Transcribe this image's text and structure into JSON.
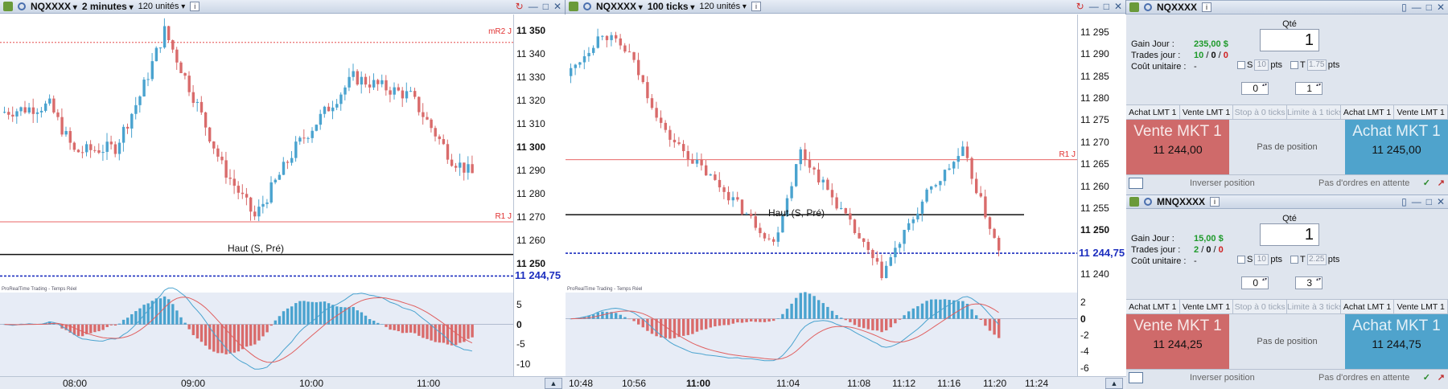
{
  "left_chart": {
    "ticker": "NQXXXX",
    "period": "2 minutes",
    "units": "120 unités",
    "price_ticks": [
      {
        "label": "11 350",
        "bold": true,
        "y": 11350
      },
      {
        "label": "11 340",
        "bold": false,
        "y": 11340
      },
      {
        "label": "11 330",
        "bold": false,
        "y": 11330
      },
      {
        "label": "11 320",
        "bold": false,
        "y": 11320
      },
      {
        "label": "11 310",
        "bold": false,
        "y": 11310
      },
      {
        "label": "11 300",
        "bold": true,
        "y": 11300
      },
      {
        "label": "11 290",
        "bold": false,
        "y": 11290
      },
      {
        "label": "11 280",
        "bold": false,
        "y": 11280
      },
      {
        "label": "11 270",
        "bold": false,
        "y": 11270
      },
      {
        "label": "11 260",
        "bold": false,
        "y": 11260
      },
      {
        "label": "11 250",
        "bold": true,
        "y": 11250
      }
    ],
    "current_price": "11 244,75",
    "level_mR2": "mR2 J",
    "level_R1": "R1 J",
    "haut_label": "Haut (S, Pré)",
    "brand": "ProRealTime Trading - Temps Réel",
    "ind_ticks": [
      {
        "label": "5",
        "bold": false,
        "v": 5
      },
      {
        "label": "0",
        "bold": true,
        "v": 0
      },
      {
        "label": "-5",
        "bold": false,
        "v": -5
      },
      {
        "label": "-10",
        "bold": false,
        "v": -10
      }
    ],
    "x_ticks": [
      {
        "label": "08:00",
        "bold": false
      },
      {
        "label": "09:00",
        "bold": false
      },
      {
        "label": "10:00",
        "bold": false
      },
      {
        "label": "11:00",
        "bold": false
      }
    ]
  },
  "right_chart": {
    "ticker": "NQXXXX",
    "period": "100 ticks",
    "units": "120 unités",
    "price_ticks": [
      {
        "label": "11 295",
        "bold": false,
        "y": 11295
      },
      {
        "label": "11 290",
        "bold": false,
        "y": 11290
      },
      {
        "label": "11 285",
        "bold": false,
        "y": 11285
      },
      {
        "label": "11 280",
        "bold": false,
        "y": 11280
      },
      {
        "label": "11 275",
        "bold": false,
        "y": 11275
      },
      {
        "label": "11 270",
        "bold": false,
        "y": 11270
      },
      {
        "label": "11 265",
        "bold": false,
        "y": 11265
      },
      {
        "label": "11 260",
        "bold": false,
        "y": 11260
      },
      {
        "label": "11 255",
        "bold": false,
        "y": 11255
      },
      {
        "label": "11 250",
        "bold": true,
        "y": 11250
      },
      {
        "label": "11 240",
        "bold": false,
        "y": 11240
      }
    ],
    "current_price": "11 244,75",
    "level_R1": "R1 J",
    "haut_label": "Haut (S, Pré)",
    "brand": "ProRealTime Trading - Temps Réel",
    "ind_ticks": [
      {
        "label": "2",
        "bold": false,
        "v": 2
      },
      {
        "label": "0",
        "bold": true,
        "v": 0
      },
      {
        "label": "-2",
        "bold": false,
        "v": -2
      },
      {
        "label": "-4",
        "bold": false,
        "v": -4
      },
      {
        "label": "-6",
        "bold": false,
        "v": -6
      }
    ],
    "x_ticks": [
      {
        "label": "10:48",
        "bold": false
      },
      {
        "label": "10:56",
        "bold": false
      },
      {
        "label": "11:00",
        "bold": true
      },
      {
        "label": "11:04",
        "bold": false
      },
      {
        "label": "11:08",
        "bold": false
      },
      {
        "label": "11:12",
        "bold": false
      },
      {
        "label": "11:16",
        "bold": false
      },
      {
        "label": "11:20",
        "bold": false
      },
      {
        "label": "11:24",
        "bold": false
      }
    ]
  },
  "panels": [
    {
      "ticker": "NQXXXX",
      "qty_label": "Qté",
      "qty": "1",
      "gain_label": "Gain Jour :",
      "gain_value": "235,00 $",
      "trades_label": "Trades jour :",
      "trades_win": "10",
      "trades_flat": "0",
      "trades_loss": "0",
      "sep": "/",
      "cost_label": "Coût unitaire :",
      "cost_value": "-",
      "s_label": "S",
      "s_value": "10",
      "t_label": "T",
      "t_value": "1.75",
      "pts": "pts",
      "spin_left": "0",
      "spin_right": "1",
      "buttons": [
        "Achat LMT 1",
        "Vente LMT 1",
        "Stop à 0 ticks",
        "Limite à 1 ticks",
        "Achat LMT 1",
        "Vente LMT 1"
      ],
      "sell_title": "Vente MKT 1",
      "sell_price": "11 244,00",
      "position": "Pas de position",
      "buy_title": "Achat MKT 1",
      "buy_price": "11 245,00",
      "invert": "Inverser position",
      "orders": "Pas d'ordres en attente"
    },
    {
      "ticker": "MNQXXXX",
      "qty_label": "Qté",
      "qty": "1",
      "gain_label": "Gain Jour :",
      "gain_value": "15,00 $",
      "trades_label": "Trades jour :",
      "trades_win": "2",
      "trades_flat": "0",
      "trades_loss": "0",
      "sep": "/",
      "cost_label": "Coût unitaire :",
      "cost_value": "-",
      "s_label": "S",
      "s_value": "10",
      "t_label": "T",
      "t_value": "2.25",
      "pts": "pts",
      "spin_left": "0",
      "spin_right": "3",
      "buttons": [
        "Achat LMT 1",
        "Vente LMT 1",
        "Stop à 0 ticks",
        "Limite à 3 ticks",
        "Achat LMT 1",
        "Vente LMT 1"
      ],
      "sell_title": "Vente MKT 1",
      "sell_price": "11 244,25",
      "position": "Pas de position",
      "buy_title": "Achat MKT 1",
      "buy_price": "11 244,75",
      "invert": "Inverser position",
      "orders": "Pas d'ordres en attente"
    }
  ],
  "colors": {
    "up": "#4aa3cf",
    "down": "#d96b6b",
    "level": "#e03030",
    "haut": "#111111",
    "current": "#1d2fbf"
  }
}
